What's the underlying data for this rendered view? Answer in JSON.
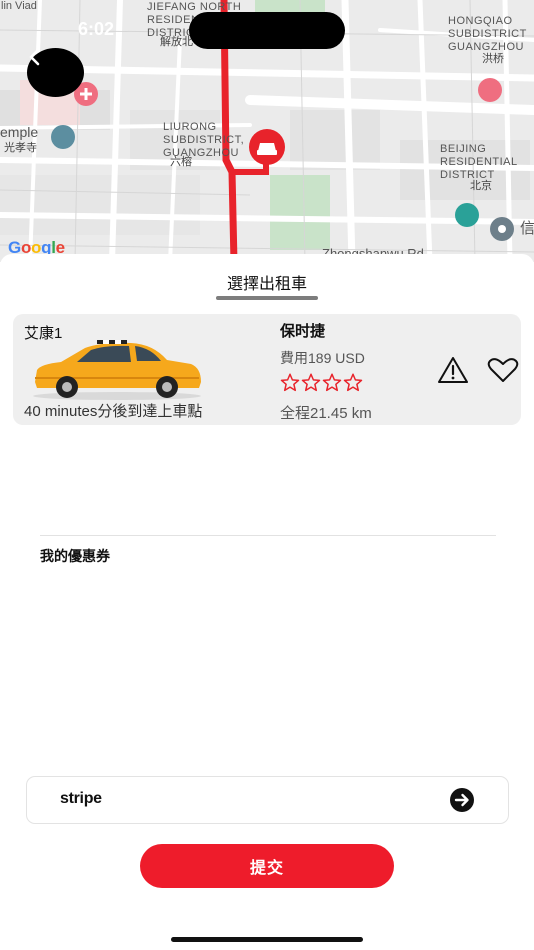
{
  "status_bar": {
    "time": "6:02"
  },
  "map": {
    "labels": {
      "jiefang": "JIEFANG NORTH\nRESIDENTIAL\nDISTRICT",
      "jiefang_cn": "解放北",
      "liurong": "LIURONG\nSUBDISTRICT,\nGUANGZHOU",
      "liurong_cn": "六榕",
      "hongqiao": "HONGQIAO\nSUBDISTRICT\nGUANGZHOU",
      "hongqiao_cn": "洪桥",
      "beijing": "BEIJING\nRESIDENTIAL\nDISTRICT",
      "beijing_cn": "北京",
      "temple": "emple",
      "temple_cn": "光孝寺",
      "road_left": "lin Viad",
      "road_bottom": "Zhongshanwu Rd",
      "xin": "信"
    },
    "attribution_letters": [
      "G",
      "o",
      "o",
      "g",
      "l",
      "e"
    ]
  },
  "sheet": {
    "title": "選擇出租車",
    "driver": {
      "name": "艾康1",
      "eta": "40 minutes分後到達上車點",
      "car_model": "保时捷",
      "fare": "費用189 USD",
      "rating_stars": 4,
      "distance": "全程21.45 km"
    },
    "coupon_title": "我的優惠券",
    "payment": {
      "provider": "stripe"
    },
    "submit_label": "提交"
  },
  "colors": {
    "accent": "#ee1c2b",
    "route": "#e8232b",
    "card_bg": "#efefef"
  }
}
